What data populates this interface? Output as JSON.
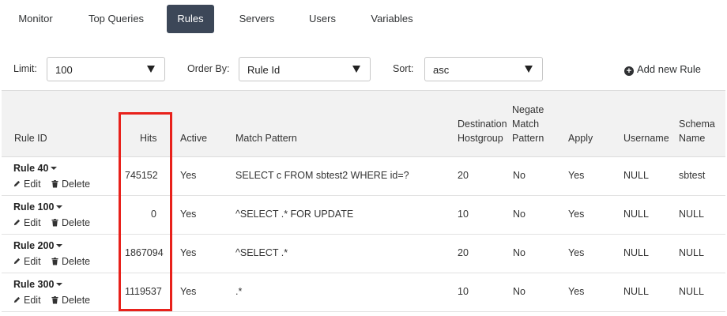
{
  "nav": {
    "tabs": [
      {
        "label": "Monitor"
      },
      {
        "label": "Top Queries"
      },
      {
        "label": "Rules",
        "active": true
      },
      {
        "label": "Servers"
      },
      {
        "label": "Users"
      },
      {
        "label": "Variables"
      }
    ]
  },
  "filters": {
    "limit_label": "Limit:",
    "limit_value": "100",
    "order_label": "Order By:",
    "order_value": "Rule Id",
    "sort_label": "Sort:",
    "sort_value": "asc",
    "add_rule_label": "Add new Rule"
  },
  "table": {
    "headers": {
      "rule_id": "Rule ID",
      "hits": "Hits",
      "active": "Active",
      "match_pattern": "Match Pattern",
      "dest_line1": "Destination",
      "dest_line2": "Hostgroup",
      "negate_line1": "Negate",
      "negate_line2": "Match",
      "negate_line3": "Pattern",
      "apply": "Apply",
      "username": "Username",
      "schema_line1": "Schema",
      "schema_line2": "Name"
    },
    "edit_label": "Edit",
    "delete_label": "Delete",
    "rows": [
      {
        "rule": "Rule 40",
        "hits": "745152",
        "active": "Yes",
        "pattern": "SELECT c FROM sbtest2 WHERE id=?",
        "dest": "20",
        "negate": "No",
        "apply": "Yes",
        "username": "NULL",
        "schema": "sbtest"
      },
      {
        "rule": "Rule 100",
        "hits": "0",
        "active": "Yes",
        "pattern": "^SELECT .* FOR UPDATE",
        "dest": "10",
        "negate": "No",
        "apply": "Yes",
        "username": "NULL",
        "schema": "NULL"
      },
      {
        "rule": "Rule 200",
        "hits": "1867094",
        "active": "Yes",
        "pattern": "^SELECT .*",
        "dest": "20",
        "negate": "No",
        "apply": "Yes",
        "username": "NULL",
        "schema": "NULL"
      },
      {
        "rule": "Rule 300",
        "hits": "1119537",
        "active": "Yes",
        "pattern": ".*",
        "dest": "10",
        "negate": "No",
        "apply": "Yes",
        "username": "NULL",
        "schema": "NULL"
      }
    ]
  },
  "colors": {
    "active_tab_bg": "#3c4758",
    "highlight": "#e8211b",
    "header_bg": "#f2f2f2"
  }
}
